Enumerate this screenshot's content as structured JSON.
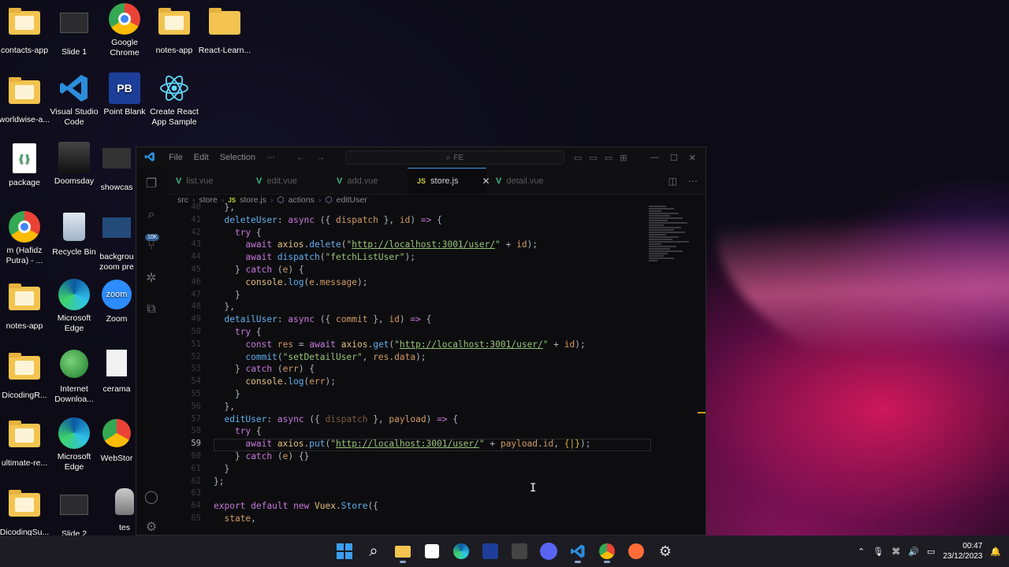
{
  "desktop": {
    "icons": [
      {
        "label": "contacts-app"
      },
      {
        "label": "Slide 1"
      },
      {
        "label": "Google Chrome"
      },
      {
        "label": "notes-app"
      },
      {
        "label": "React-Learn..."
      },
      {
        "label": "worldwise-a..."
      },
      {
        "label": "Visual Studio Code"
      },
      {
        "label": "Point Blank"
      },
      {
        "label": "Create React App Sample"
      },
      {
        "label": "package"
      },
      {
        "label": "Doomsday"
      },
      {
        "label": "showcas"
      },
      {
        "label": "m (Hafidz Putra) - ..."
      },
      {
        "label": "Recycle Bin"
      },
      {
        "label": "backgrou zoom pre"
      },
      {
        "label": "notes-app"
      },
      {
        "label": "Microsoft Edge"
      },
      {
        "label": "Zoom"
      },
      {
        "label": "DicodingR..."
      },
      {
        "label": "Internet Downloa..."
      },
      {
        "label": "cerama"
      },
      {
        "label": "ultimate-re..."
      },
      {
        "label": "Microsoft Edge"
      },
      {
        "label": "WebStor"
      },
      {
        "label": "DicodingSu..."
      },
      {
        "label": "Slide 2"
      },
      {
        "label": "tes"
      }
    ]
  },
  "vscode": {
    "menu": [
      "File",
      "Edit",
      "Selection",
      "···"
    ],
    "search_text": "FE",
    "tabs": [
      {
        "label": "list.vue",
        "kind": "vue"
      },
      {
        "label": "edit.vue",
        "kind": "vue"
      },
      {
        "label": "add.vue",
        "kind": "vue"
      },
      {
        "label": "store.js",
        "kind": "js",
        "active": true
      },
      {
        "label": "detail.vue",
        "kind": "vue"
      }
    ],
    "tab_close": "✕",
    "breadcrumb": [
      "src",
      "store",
      "store.js",
      "actions",
      "editUser"
    ],
    "activity_badge": "10K",
    "current_line": 59
  },
  "taskbar": {
    "time": "00:47",
    "date": "23/12/2023"
  }
}
